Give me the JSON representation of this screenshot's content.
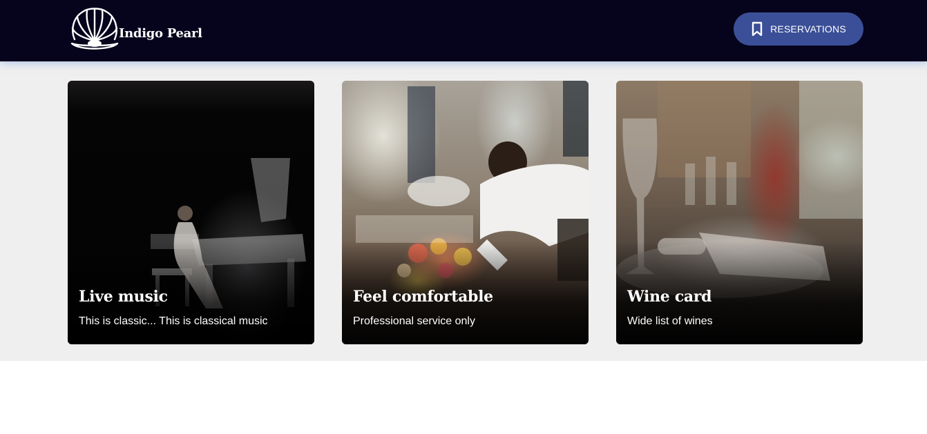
{
  "header": {
    "brand_name": "Indigo Pearl",
    "logo_icon": "shell-pearl-logo",
    "reservations_label": "RESERVATIONS",
    "reservations_icon": "bookmark-icon",
    "background": "#05041c",
    "button_color": "#3b4f98"
  },
  "cards": [
    {
      "title": "Live music",
      "description": "This is classic... This is classical music"
    },
    {
      "title": "Feel comfortable",
      "description": "Professional service only"
    },
    {
      "title": "Wine card",
      "description": "Wide list of wines"
    }
  ],
  "colors": {
    "section_background": "#efefef",
    "page_background": "#ffffff"
  }
}
